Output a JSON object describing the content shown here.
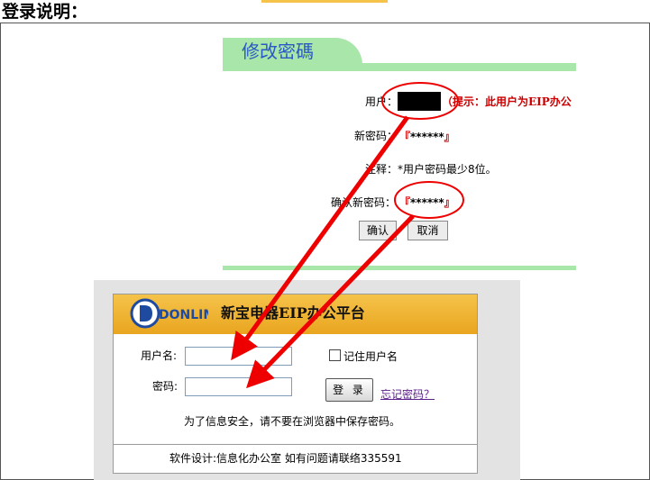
{
  "doc": {
    "title": "登录说明："
  },
  "change_password": {
    "tab_title": "修改密碼",
    "user_label": "用户：",
    "hint": "（提示：此用户为EIP办公",
    "new_password_label": "新密码：",
    "new_password_value": "******",
    "note": "注释：*用户密码最少8位。",
    "confirm_label": "确认新密码：",
    "confirm_value": "******",
    "confirm_button": "确认",
    "cancel_button": "取消"
  },
  "login": {
    "logo_text": "DONLIM",
    "title": "新宝电器EIP办公平台",
    "username_label": "用户名:",
    "username_value": "",
    "password_label": "密码:",
    "password_value": "",
    "remember_label": "记住用户名",
    "login_button": "登 录",
    "forgot_link": "忘记密码？",
    "notice": "为了信息安全，请不要在浏览器中保存密码。",
    "footer": "软件设计:信息化办公室 如有问题请联络335591"
  },
  "colors": {
    "accent_green": "#a9e6a9",
    "tab_title_blue": "#2a58c6",
    "header_orange": "#f0b030",
    "annotation_red": "#ee0000",
    "hint_red": "#cc0000"
  }
}
